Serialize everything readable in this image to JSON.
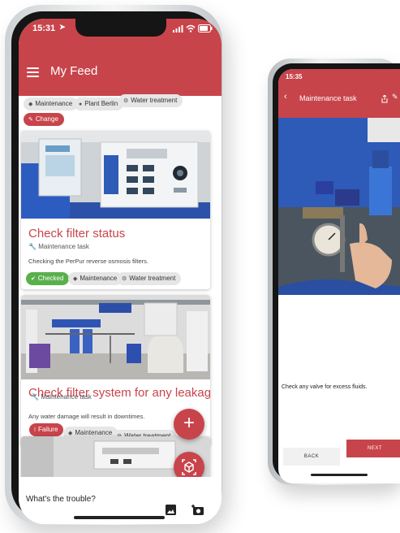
{
  "feed": {
    "time": "15:31",
    "title": "My Feed",
    "filter_chips": [
      "Maintenance",
      "Plant Berlin",
      "Water treatment"
    ],
    "change_label": "Change",
    "cards": [
      {
        "title": "Check filter status",
        "type": "Maintenance task",
        "description": "Checking the PerPur reverse osmosis filters.",
        "tags": [
          "Checked",
          "Maintenance",
          "Water treatment"
        ]
      },
      {
        "title": "Check filter system for any leakage",
        "type": "Maintenance task",
        "description": "Any water damage will result in downtimes.",
        "tags": [
          "Failure",
          "Maintenance",
          "Water treatment"
        ]
      }
    ],
    "trouble_prompt": "What's the trouble?",
    "colors": {
      "primary": "#c8444b",
      "checked": "#59b04b",
      "chip": "#e6e6e6"
    }
  },
  "task": {
    "time": "15:35",
    "title": "Maintenance task",
    "instruction": "Check any valve for excess fluids.",
    "back_label": "BACK",
    "next_label": "NEXT"
  }
}
